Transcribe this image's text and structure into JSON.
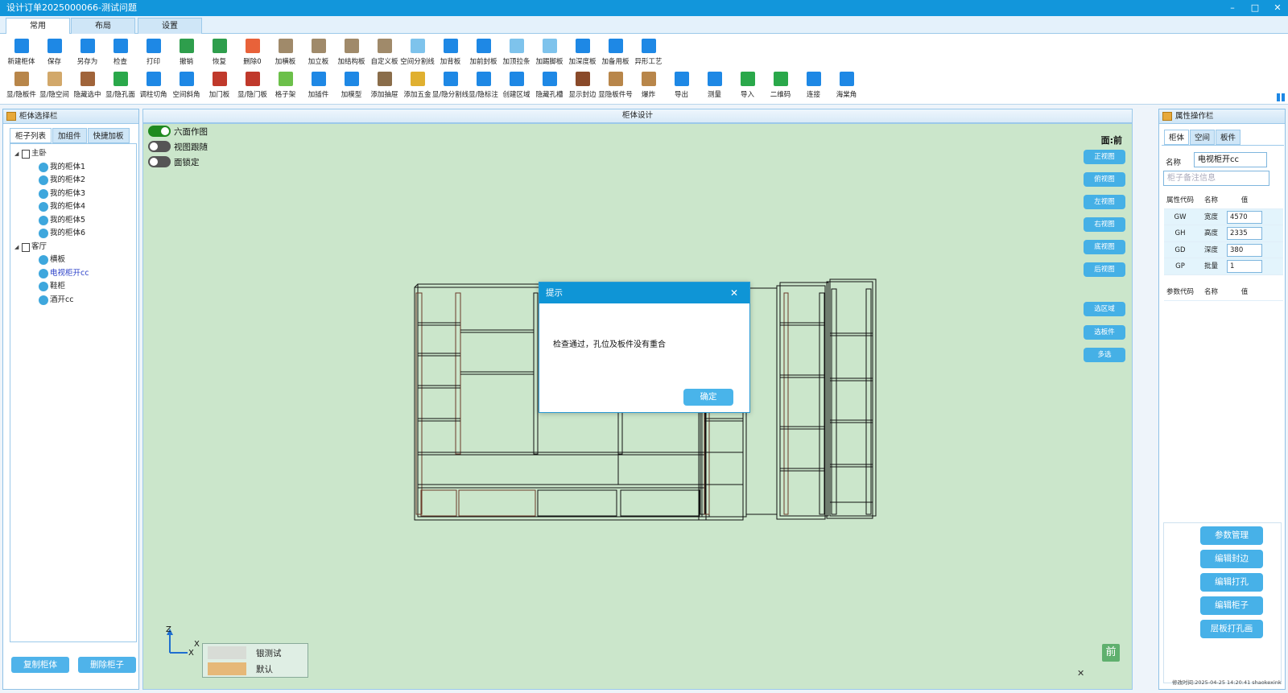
{
  "window": {
    "title": "设计订单2025000066-测试问题",
    "controls": [
      "–",
      "□",
      "✕"
    ]
  },
  "ribbon_tabs": [
    "常用",
    "布局",
    "设置"
  ],
  "toolbar_row1": [
    {
      "label": "新建柜体",
      "icon": "new-cabinet-icon",
      "color": "#1e88e5"
    },
    {
      "label": "保存",
      "icon": "save-icon",
      "color": "#1e88e5"
    },
    {
      "label": "另存为",
      "icon": "save-as-icon",
      "color": "#1e88e5"
    },
    {
      "label": "检查",
      "icon": "check-icon",
      "color": "#1e88e5"
    },
    {
      "label": "打印",
      "icon": "print-icon",
      "color": "#1e88e5"
    },
    {
      "label": "撤销",
      "icon": "undo-icon",
      "color": "#2e9e4c"
    },
    {
      "label": "恢复",
      "icon": "redo-icon",
      "color": "#2e9e4c"
    },
    {
      "label": "删除0",
      "icon": "delete-icon",
      "color": "#e8623a"
    },
    {
      "label": "加横板",
      "icon": "add-horizontal-board-icon",
      "color": "#a08a6a"
    },
    {
      "label": "加立板",
      "icon": "add-vertical-board-icon",
      "color": "#a08a6a"
    },
    {
      "label": "加结构板",
      "icon": "add-structure-board-icon",
      "color": "#a08a6a"
    },
    {
      "label": "自定义板",
      "icon": "custom-board-icon",
      "color": "#a08a6a"
    },
    {
      "label": "空间分割线",
      "icon": "space-divider-icon",
      "color": "#7ec3ec"
    },
    {
      "label": "加背板",
      "icon": "add-back-board-icon",
      "color": "#1e88e5"
    },
    {
      "label": "加前封板",
      "icon": "add-front-panel-icon",
      "color": "#1e88e5"
    },
    {
      "label": "加顶拉条",
      "icon": "add-top-strip-icon",
      "color": "#7ec3ec"
    },
    {
      "label": "加踢脚板",
      "icon": "add-kickboard-icon",
      "color": "#7ec3ec"
    },
    {
      "label": "加深度板",
      "icon": "add-depth-board-icon",
      "color": "#1e88e5"
    },
    {
      "label": "加备用板",
      "icon": "add-spare-board-icon",
      "color": "#1e88e5"
    },
    {
      "label": "异形工艺",
      "icon": "special-process-icon",
      "color": "#1e88e5"
    }
  ],
  "toolbar_row2": [
    {
      "label": "显/隐板件",
      "icon": "toggle-panels-icon",
      "color": "#b8864a"
    },
    {
      "label": "显/隐空间",
      "icon": "toggle-space-icon",
      "color": "#d2a86a"
    },
    {
      "label": "隐藏选中",
      "icon": "hide-selected-icon",
      "color": "#a0643a"
    },
    {
      "label": "显/隐孔面",
      "icon": "toggle-holes-icon",
      "color": "#2aa84a"
    },
    {
      "label": "调柱切角",
      "icon": "column-chamfer-icon",
      "color": "#1e88e5"
    },
    {
      "label": "空间斜角",
      "icon": "space-bevel-icon",
      "color": "#1e88e5"
    },
    {
      "label": "加门板",
      "icon": "add-door-icon",
      "color": "#c0392b"
    },
    {
      "label": "显/隐门板",
      "icon": "toggle-doors-icon",
      "color": "#c0392b"
    },
    {
      "label": "格子架",
      "icon": "grid-rack-icon",
      "color": "#6cc04a"
    },
    {
      "label": "加插件",
      "icon": "add-plugin-icon",
      "color": "#1e88e5"
    },
    {
      "label": "加模型",
      "icon": "add-model-icon",
      "color": "#1e88e5"
    },
    {
      "label": "添加抽屉",
      "icon": "add-drawer-icon",
      "color": "#8a6d4a"
    },
    {
      "label": "添加五金",
      "icon": "add-hardware-icon",
      "color": "#e0b030"
    },
    {
      "label": "显/隐分割线",
      "icon": "toggle-divider-icon",
      "color": "#1e88e5"
    },
    {
      "label": "显/隐标注",
      "icon": "toggle-dimension-icon",
      "color": "#1e88e5"
    },
    {
      "label": "创建区域",
      "icon": "create-area-icon",
      "color": "#1e88e5"
    },
    {
      "label": "隐藏孔槽",
      "icon": "hide-holes-icon",
      "color": "#1e88e5"
    },
    {
      "label": "显示封边",
      "icon": "show-edging-icon",
      "color": "#8a4a2a"
    },
    {
      "label": "显隐板件号",
      "icon": "toggle-panel-number-icon",
      "color": "#b8864a"
    },
    {
      "label": "爆炸",
      "icon": "explode-icon",
      "color": "#b8864a"
    },
    {
      "label": "导出",
      "icon": "export-icon",
      "color": "#1e88e5"
    },
    {
      "label": "测量",
      "icon": "measure-icon",
      "color": "#1e88e5"
    },
    {
      "label": "导入",
      "icon": "import-icon",
      "color": "#2aa84a"
    },
    {
      "label": "二维码",
      "icon": "qrcode-icon",
      "color": "#2aa84a"
    },
    {
      "label": "连接",
      "icon": "connect-icon",
      "color": "#1e88e5"
    },
    {
      "label": "海棠角",
      "icon": "begonia-corner-icon",
      "color": "#1e88e5"
    }
  ],
  "left_panel": {
    "title": "柜体选择栏",
    "tabs": [
      "柜子列表",
      "加组件",
      "快捷加板"
    ],
    "tree": [
      {
        "type": "root",
        "label": "主卧"
      },
      {
        "type": "child",
        "label": "我的柜体1"
      },
      {
        "type": "child",
        "label": "我的柜体2"
      },
      {
        "type": "child",
        "label": "我的柜体3"
      },
      {
        "type": "child",
        "label": "我的柜体4"
      },
      {
        "type": "child",
        "label": "我的柜体5"
      },
      {
        "type": "child",
        "label": "我的柜体6"
      },
      {
        "type": "root",
        "label": "客厅"
      },
      {
        "type": "child",
        "label": "横板"
      },
      {
        "type": "child",
        "label": "电视柜开cc",
        "selected": true
      },
      {
        "type": "child",
        "label": "鞋柜"
      },
      {
        "type": "child",
        "label": "酒开cc"
      }
    ],
    "buttons": {
      "copy": "复制柜体",
      "delete": "删除柜子"
    }
  },
  "canvas": {
    "header": "柜体设计",
    "toggles": [
      {
        "label": "六面作图",
        "on": true
      },
      {
        "label": "视图跟随",
        "on": false
      },
      {
        "label": "面锁定",
        "on": false
      }
    ],
    "face_label": "面:前",
    "view_buttons": [
      "正视图",
      "俯视图",
      "左视图",
      "右视图",
      "底视图",
      "后视图"
    ],
    "select_buttons": [
      "选区域",
      "选板件",
      "多选"
    ],
    "axis": {
      "z": "Z",
      "x": "X"
    },
    "materials": [
      {
        "name": "银测试",
        "swatch": "#d8dcd6"
      },
      {
        "name": "默认",
        "swatch": "#e6b878"
      }
    ],
    "front_badge": "前",
    "close": "✕"
  },
  "dialog": {
    "title": "提示",
    "message": "检查通过，孔位及板件没有重合",
    "ok": "确定",
    "close": "✕"
  },
  "right_panel": {
    "title": "属性操作栏",
    "tabs": [
      "柜体",
      "空间",
      "板件"
    ],
    "name_label": "名称",
    "name_value": "电视柜开cc",
    "remark_placeholder": "柜子备注信息",
    "attr_headers": [
      "属性代码",
      "名称",
      "值"
    ],
    "attrs": [
      {
        "code": "GW",
        "name": "宽度",
        "value": "4570"
      },
      {
        "code": "GH",
        "name": "高度",
        "value": "2335"
      },
      {
        "code": "GD",
        "name": "深度",
        "value": "380"
      },
      {
        "code": "GP",
        "name": "批量",
        "value": "1"
      }
    ],
    "param_headers": [
      "参数代码",
      "名称",
      "值"
    ],
    "buttons": [
      "参数管理",
      "编辑封边",
      "编辑打孔",
      "编辑柜子",
      "层板打孔画"
    ],
    "footer": "修改时间:2025-04-25 14:20:41 shaokexink"
  }
}
